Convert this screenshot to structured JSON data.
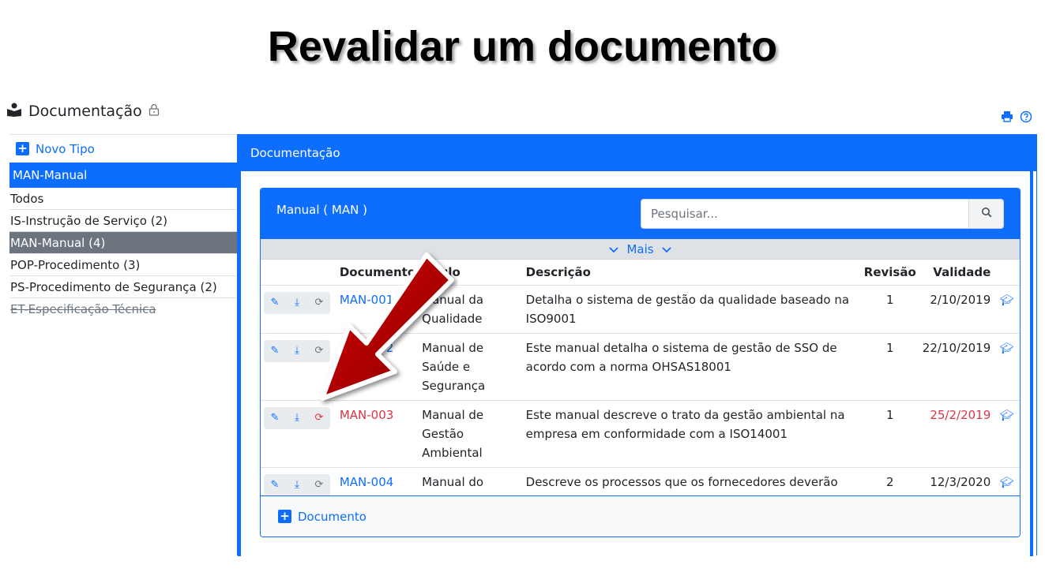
{
  "slide_title": "Revalidar um documento",
  "header": {
    "title": "Documentação",
    "lock_icon": "lock-icon"
  },
  "header_icons": {
    "print": "print-icon",
    "help": "help-icon"
  },
  "sidebar": {
    "new_type_label": "Novo Tipo",
    "active_type": "MAN-Manual",
    "items": [
      {
        "label": "Todos",
        "selected": false,
        "disabled": false
      },
      {
        "label": "IS-Instrução de Serviço (2)",
        "selected": false,
        "disabled": false
      },
      {
        "label": "MAN-Manual (4)",
        "selected": true,
        "disabled": false
      },
      {
        "label": "POP-Procedimento (3)",
        "selected": false,
        "disabled": false
      },
      {
        "label": "PS-Procedimento de Segurança (2)",
        "selected": false,
        "disabled": false
      },
      {
        "label": "ET-Especificação Técnica",
        "selected": false,
        "disabled": true
      }
    ]
  },
  "main": {
    "panel_title": "Documentação",
    "card_title": "Manual ( MAN )",
    "search": {
      "placeholder": "Pesquisar..."
    },
    "more_label": "Mais",
    "columns": {
      "document": "Documento",
      "title": "Título",
      "description": "Descrição",
      "revision": "Revisão",
      "validity": "Validade"
    },
    "rows": [
      {
        "code": "MAN-001",
        "title": "Manual da Qualidade",
        "description": "Detalha o sistema de gestão da qualidade baseado na ISO9001",
        "revision": "1",
        "validity": "2/10/2019",
        "expired": false
      },
      {
        "code": "MAN-002",
        "title": "Manual de Saúde e Segurança",
        "description": "Este manual detalha o sistema de gestão de SSO de acordo com a norma OHSAS18001",
        "revision": "1",
        "validity": "22/10/2019",
        "expired": false
      },
      {
        "code": "MAN-003",
        "title": "Manual de Gestão Ambiental",
        "description": "Este manual descreve o trato da gestão ambiental na empresa em conformidade com a ISO14001",
        "revision": "1",
        "validity": "25/2/2019",
        "expired": true
      },
      {
        "code": "MAN-004",
        "title": "Manual do Fornecedor",
        "description": "Descreve os processos que os fornecedores deverão respeitar para garantir a segurança dos seus trabalhadores.",
        "revision": "2",
        "validity": "12/3/2020",
        "expired": false
      }
    ],
    "add_document_label": "Documento"
  },
  "colors": {
    "primary": "#0d6efd",
    "danger": "#dc3545",
    "selected_bg": "#6c757d",
    "arrow": "#b30000"
  }
}
